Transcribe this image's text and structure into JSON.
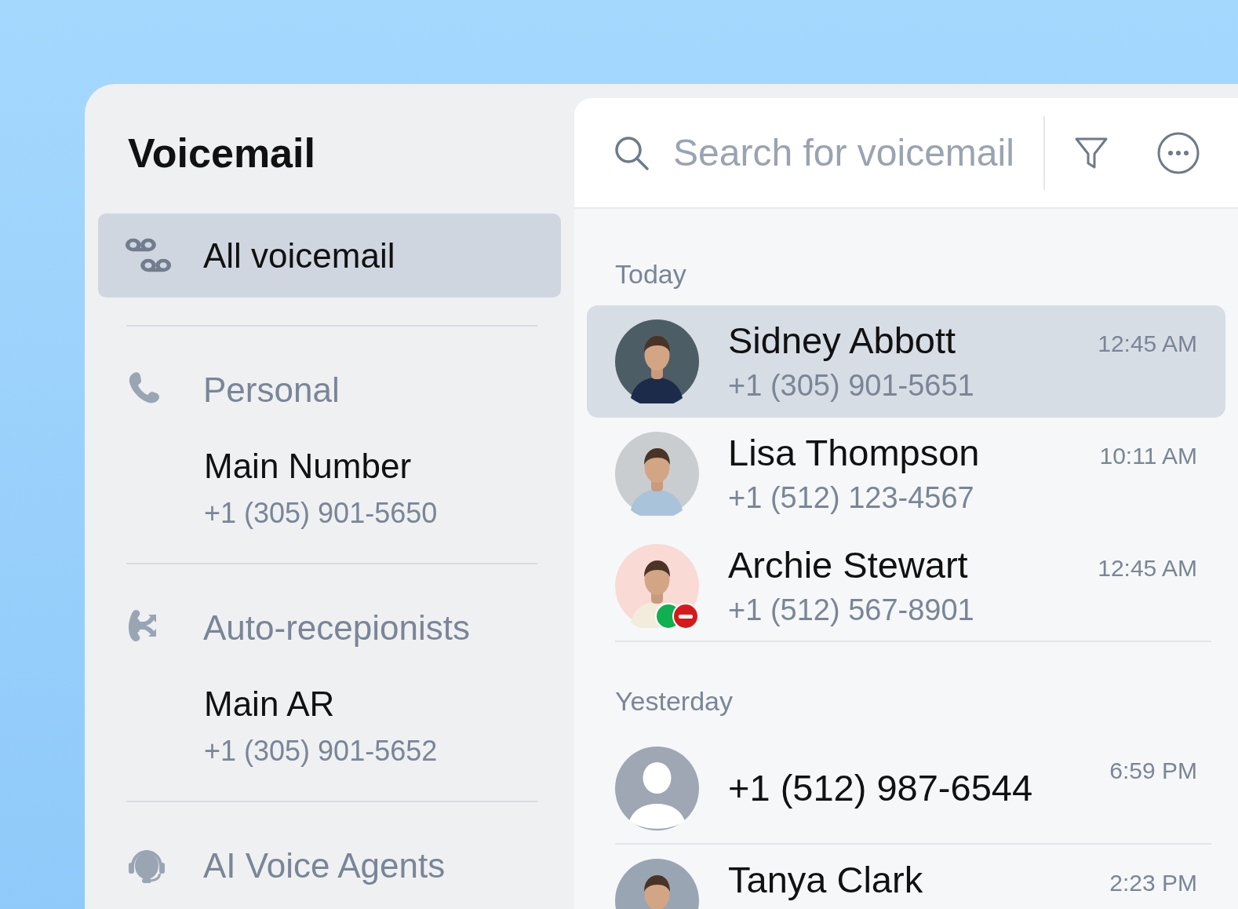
{
  "sidebar": {
    "title": "Voicemail",
    "all": {
      "label": "All voicemail",
      "selected": true
    },
    "groups": [
      {
        "kind": "personal",
        "label": "Personal",
        "lines": [
          {
            "name": "Main Number",
            "phone": "+1 (305) 901-5650"
          }
        ]
      },
      {
        "kind": "auto",
        "label": "Auto-recepionists",
        "lines": [
          {
            "name": "Main AR",
            "phone": "+1 (305) 901-5652"
          }
        ]
      },
      {
        "kind": "ai",
        "label": "AI Voice Agents"
      }
    ]
  },
  "search": {
    "placeholder": "Search for voicemail"
  },
  "sections": [
    {
      "label": "Today",
      "items": [
        {
          "kind": "picture",
          "name": "Sidney Abbott",
          "phone": "+1 (305) 901-5651",
          "time": "12:45 AM",
          "selected": true
        },
        {
          "kind": "picture",
          "name": "Lisa Thompson",
          "phone": "+1 (512) 123-4567",
          "time": "10:11 AM",
          "selected": false
        },
        {
          "kind": "picture",
          "name": "Archie Stewart",
          "phone": "+1 (512) 567-8901",
          "time": "12:45 AM",
          "selected": false,
          "statuses": [
            {
              "kind": "dot",
              "color": "#10b050"
            },
            {
              "kind": "blocked",
              "color": "#d7191c"
            }
          ]
        }
      ]
    },
    {
      "label": "Yesterday",
      "items": [
        {
          "kind": "placeholder",
          "name": "+1 (512) 987-6544",
          "time": "6:59 PM",
          "selected": false
        },
        {
          "kind": "picture",
          "name": "Tanya Clark",
          "time": "2:23 PM",
          "selected": false
        }
      ]
    }
  ]
}
